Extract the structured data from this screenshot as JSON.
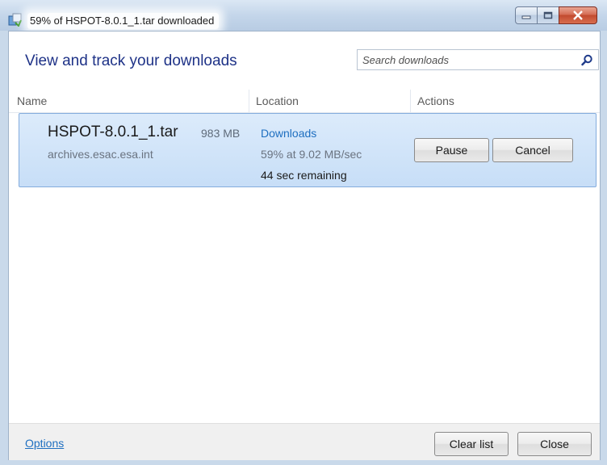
{
  "window": {
    "title": "59% of HSPOT-8.0.1_1.tar downloaded",
    "controls": [
      "minimize-icon",
      "maximize-icon",
      "close-icon"
    ]
  },
  "header": {
    "title": "View and track your downloads",
    "search_placeholder": "Search downloads",
    "search_icon": "search-icon"
  },
  "columns": {
    "name": "Name",
    "location": "Location",
    "actions": "Actions"
  },
  "download": {
    "file_name": "HSPOT-8.0.1_1.tar",
    "size": "983 MB",
    "source": "archives.esac.esa.int",
    "location": "Downloads",
    "progress_text": "59% at 9.02 MB/sec",
    "remaining": "44 sec remaining",
    "pause_label": "Pause",
    "cancel_label": "Cancel"
  },
  "footer": {
    "options_label": "Options",
    "clear_list_label": "Clear list",
    "close_label": "Close"
  },
  "colors": {
    "accent_link": "#1e6fc0",
    "header_text": "#1e3287",
    "selected_row": "#c7def7"
  }
}
